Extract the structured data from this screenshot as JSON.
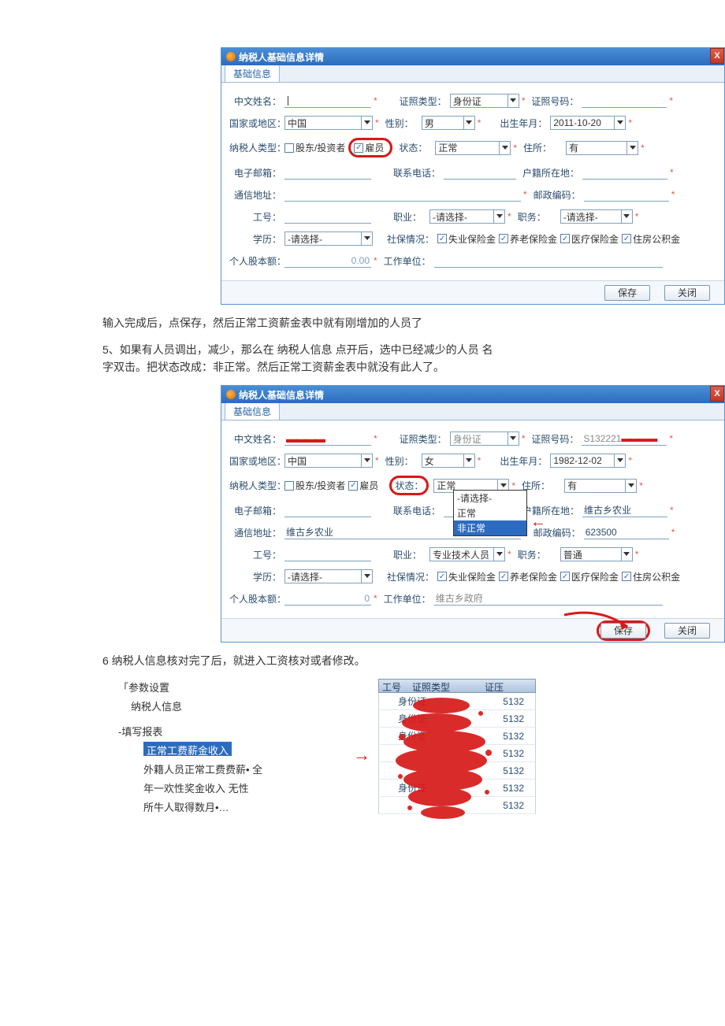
{
  "dialog1": {
    "title": "纳税人基础信息详情",
    "tab": "基础信息",
    "labels": {
      "chinese_name": "中文姓名：",
      "id_type": "证照类型：",
      "id_type_val": "身份证",
      "id_no": "证照号码：",
      "country": "国家或地区：",
      "country_val": "中国",
      "gender": "性别：",
      "gender_val": "男",
      "birth": "出生年月：",
      "birth_val": "2011-10-20",
      "tax_kind": "纳税人类型：",
      "tax_kind_opt1": "股东/投资者",
      "tax_kind_opt2": "雇员",
      "status": "状态：",
      "status_val": "正常",
      "residence": "住所：",
      "residence_val": "有",
      "email": "电子邮箱：",
      "phone": "联系电话：",
      "hukou": "户籍所在地：",
      "addr": "通信地址：",
      "postcode": "邮政编码：",
      "emp_no": "工号：",
      "occupation": "职业：",
      "occupation_val": "-请选择-",
      "post": "职务：",
      "post_val": "-请选择-",
      "edu": "学历：",
      "edu_val": "-请选择-",
      "social": "社保情况：",
      "s1": "失业保险金",
      "s2": "养老保险金",
      "s3": "医疗保险金",
      "s4": "住房公积金",
      "capital": "个人股本额：",
      "capital_val": "0.00",
      "workunit": "工作单位："
    },
    "buttons": {
      "save": "保存",
      "close": "关闭"
    }
  },
  "para1": "输入完成后，点保存，然后正常工资薪金表中就有刚增加的人员了",
  "para2a": "5、如果有人员调出，减少，那么在 纳税人信息 点开后，选中已经减少的人员 名",
  "para2b": "字双击。把状态改成：非正常。然后正常工资薪金表中就没有此人了。",
  "dialog2": {
    "title": "纳税人基础信息详情",
    "tab": "基础信息",
    "id_type_val": "身份证",
    "id_no_val": "S132221",
    "country_val": "中国",
    "gender_val": "女",
    "birth_val": "1982-12-02",
    "status_val": "正常",
    "status_opts": [
      "-请选择-",
      "正常",
      "非正常"
    ],
    "residence_val": "有",
    "hukou_val": "维古乡农业",
    "addr_val": "维古乡农业",
    "postcode_val": "623500",
    "occupation_val": "专业技术人员",
    "post_val": "普通",
    "capital_val": "0",
    "workunit_val": "维古乡政府"
  },
  "para3": "6 纳税人信息核对完了后，就进入工资核对或者修改。",
  "tree": {
    "n0a": "「参数设置",
    "n1a": "纳税人信息",
    "n0b": "-填写报表",
    "n2_sel": "正常工费薪金收入",
    "n2b": "外籍人员正常工费费薪• 全",
    "n2c": "年一欢性奖金收入 无性",
    "n2d": "所牛人取得数月•…"
  },
  "grid": {
    "h1": "工号",
    "h2": "证照类型",
    "h3": "证压",
    "rows": [
      {
        "c1": "身份证",
        "c2": "5132"
      },
      {
        "c1": "身份证",
        "c2": "5132"
      },
      {
        "c1": "身份证",
        "c2": "5132"
      },
      {
        "c1": "",
        "c2": "5132"
      },
      {
        "c1": "",
        "c2": "5132"
      },
      {
        "c1": "身份证",
        "c2": "5132"
      },
      {
        "c1": "",
        "c2": "5132"
      }
    ]
  }
}
